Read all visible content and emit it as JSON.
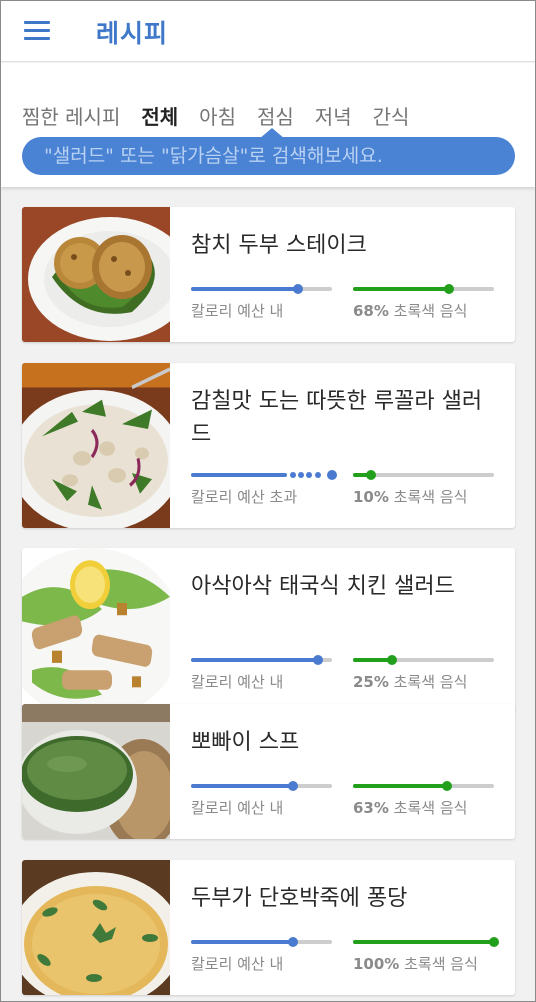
{
  "app": {
    "title": "레시피"
  },
  "tabs": [
    {
      "label": "찜한 레시피",
      "active": false
    },
    {
      "label": "전체",
      "active": true
    },
    {
      "label": "아침",
      "active": false
    },
    {
      "label": "점심",
      "active": false
    },
    {
      "label": "저녁",
      "active": false
    },
    {
      "label": "간식",
      "active": false
    }
  ],
  "search": {
    "placeholder": "\"샐러드\" 또는 \"닭가슴살\"로 검색해보세요."
  },
  "colors": {
    "accent": "#3f78c9",
    "calorie": "#4a7bd0",
    "green": "#22a01c"
  },
  "recipes": [
    {
      "title": "참치 두부 스테이크",
      "calorie_label": "칼로리 예산 내",
      "calorie_level": 0.76,
      "calorie_over": false,
      "green_pct": "68%",
      "green_suffix": " 초록색 음식",
      "green_level": 0.68,
      "image": "tuna-tofu-steak"
    },
    {
      "title": "감칠맛 도는 따뜻한 루꼴라 샐러드",
      "calorie_label": "칼로리 예산 초과",
      "calorie_level": 1.0,
      "calorie_over": true,
      "green_pct": "10%",
      "green_suffix": " 초록색 음식",
      "green_level": 0.13,
      "image": "arugula-salad"
    },
    {
      "title": "아삭아삭 태국식 치킨 샐러드",
      "calorie_label": "칼로리 예산 내",
      "calorie_level": 0.9,
      "calorie_over": false,
      "green_pct": "25%",
      "green_suffix": " 초록색 음식",
      "green_level": 0.28,
      "image": "thai-chicken-salad"
    },
    {
      "title": "뽀빠이 스프",
      "calorie_label": "칼로리 예산 내",
      "calorie_level": 0.72,
      "calorie_over": false,
      "green_pct": "63%",
      "green_suffix": " 초록색 음식",
      "green_level": 0.67,
      "image": "popeye-soup"
    },
    {
      "title": "두부가 단호박죽에 퐁당",
      "calorie_label": "칼로리 예산 내",
      "calorie_level": 0.72,
      "calorie_over": false,
      "green_pct": "100%",
      "green_suffix": " 초록색 음식",
      "green_level": 1.0,
      "image": "pumpkin-tofu-porridge"
    }
  ]
}
